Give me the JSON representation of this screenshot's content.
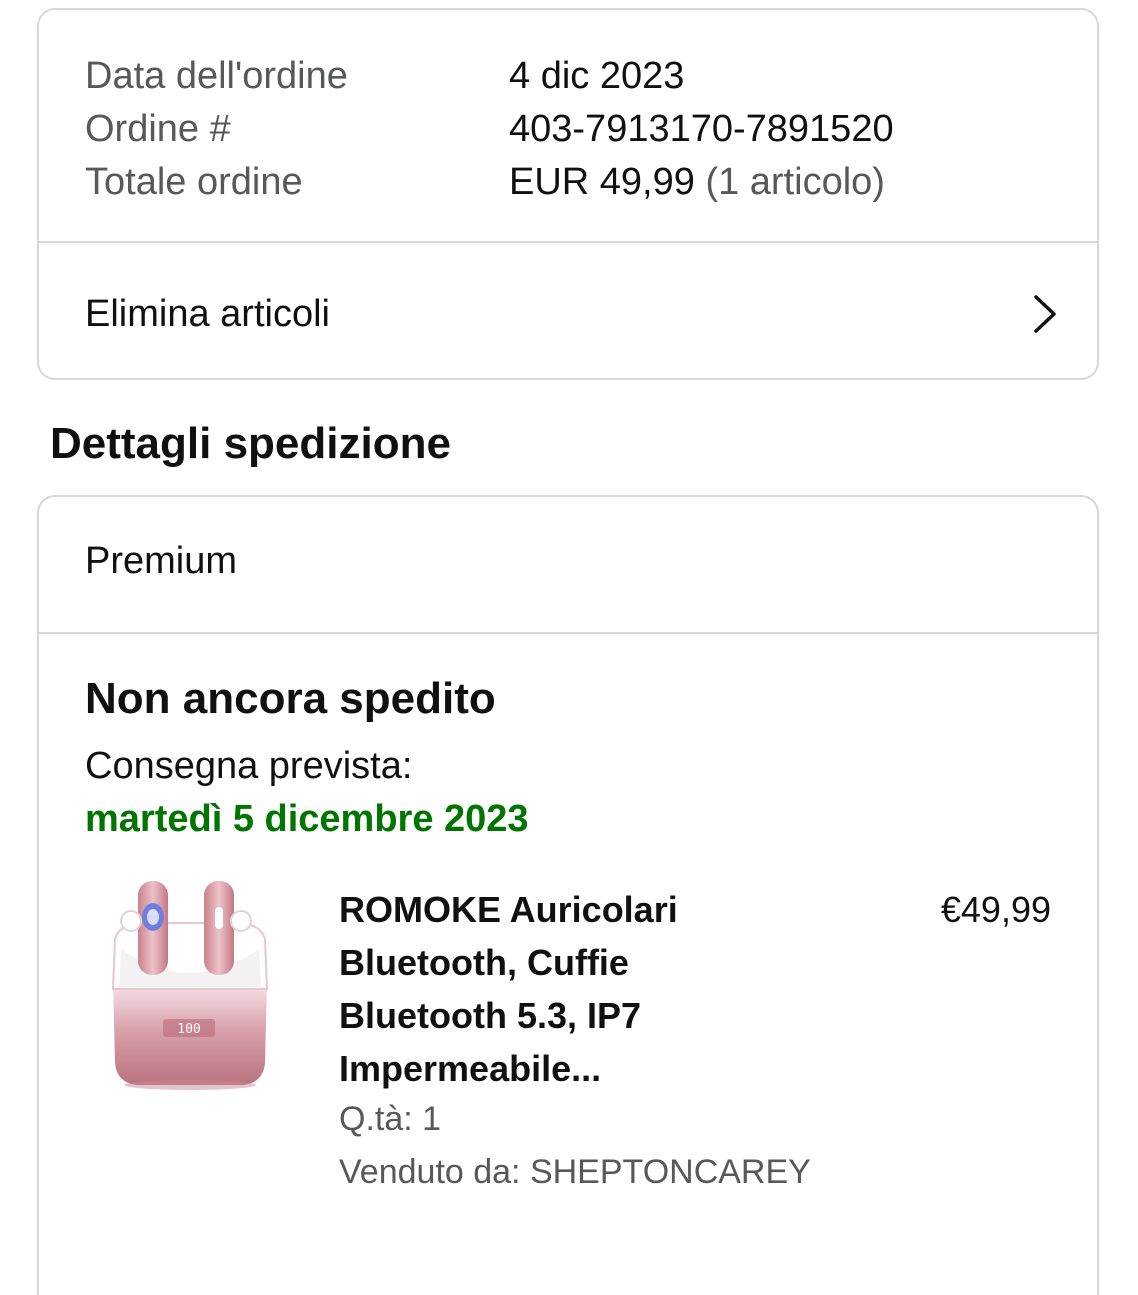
{
  "order": {
    "date_label": "Data dell'ordine",
    "date_value": "4 dic 2023",
    "number_label": "Ordine #",
    "number_value": "403-7913170-7891520",
    "total_label": "Totale ordine",
    "total_value": "EUR 49,99",
    "total_items": "(1 articolo)",
    "delete_items_label": "Elimina articoli"
  },
  "shipping": {
    "section_title": "Dettagli spedizione",
    "type": "Premium",
    "status": "Non ancora spedito",
    "delivery_label": "Consegna prevista:",
    "delivery_date": "martedì 5 dicembre 2023",
    "delivery_date_color": "#007600"
  },
  "product": {
    "title": "ROMOKE Auricolari Bluetooth, Cuffie Bluetooth 5.3, IP7 Impermeabile...",
    "price": "€49,99",
    "quantity": "Q.tà: 1",
    "seller": "Venduto da: SHEPTONCAREY",
    "image_display": "100",
    "image_icon": "pink-earbuds-case-image"
  },
  "icons": {
    "chevron": "chevron-right-icon"
  }
}
